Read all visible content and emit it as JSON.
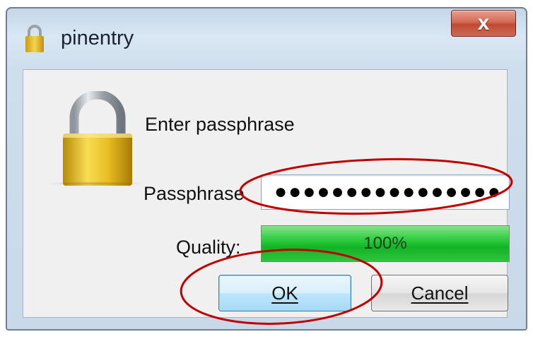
{
  "window": {
    "title": "pinentry",
    "title_icon": "lock-icon",
    "close_label": "x",
    "close_color": "#c9523c"
  },
  "dialog": {
    "prompt": "Enter passphrase",
    "passphrase_label": "Passphrase",
    "passphrase_value": "●●●●●●●●●●●●●●●●",
    "lock_icon": "padlock-icon",
    "quality_label": "Quality:",
    "quality_text": "100%",
    "quality_percent": 100,
    "quality_color": "#1ab82c"
  },
  "buttons": {
    "ok_label": "OK",
    "cancel_label": "Cancel"
  },
  "annotations": {
    "color": "#c00000",
    "items": [
      "passphrase-highlight",
      "ok-highlight"
    ]
  }
}
